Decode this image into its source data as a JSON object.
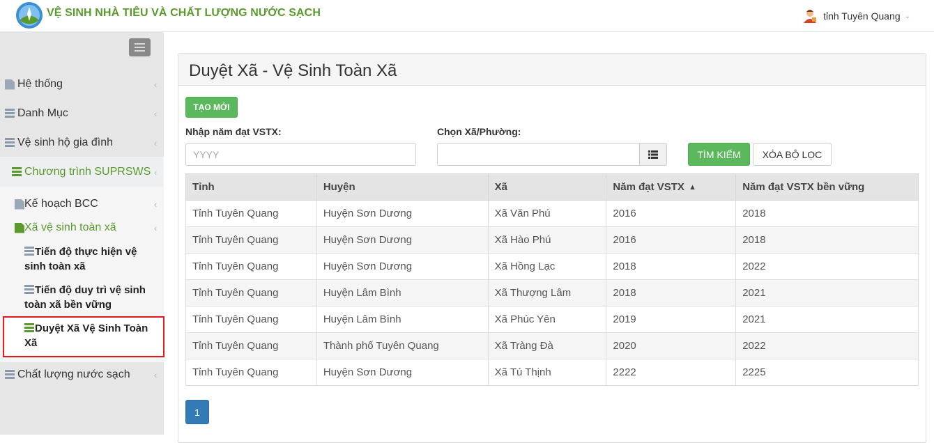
{
  "header": {
    "title": "VỆ SINH NHÀ TIÊU VÀ CHẤT LƯỢNG NƯỚC SẠCH",
    "user_name": "tỉnh Tuyên Quang",
    "brand_color": "#5a9a2c"
  },
  "sidebar": {
    "items": [
      {
        "label": "Hệ thống",
        "icon": "file-icon"
      },
      {
        "label": "Danh Mục",
        "icon": "list-icon"
      },
      {
        "label": "Vệ sinh hộ gia đình",
        "icon": "list-icon"
      },
      {
        "label": "Chương trình SUPRSWS",
        "icon": "list-icon"
      },
      {
        "label": "Kế hoạch BCC",
        "icon": "file-icon"
      },
      {
        "label": "Xã vệ sinh toàn xã",
        "icon": "file-icon"
      },
      {
        "label": "Chất lượng nước sạch",
        "icon": "list-icon"
      }
    ],
    "subitems": [
      {
        "label": "Tiến độ thực hiện vệ sinh toàn xã"
      },
      {
        "label": "Tiến độ duy trì vệ sinh toàn xã bền vững"
      },
      {
        "label": "Duyệt Xã Vệ Sinh Toàn Xã"
      }
    ]
  },
  "main": {
    "title": "Duyệt Xã - Vệ Sinh Toàn Xã",
    "create_label": "TẠO MỚI",
    "year_label": "Nhập năm đạt VSTX:",
    "year_placeholder": "YYYY",
    "commune_label": "Chọn Xã/Phường:",
    "search_label": "TÌM KIẾM",
    "clear_label": "XÓA BỘ LỌC",
    "columns": [
      "Tỉnh",
      "Huyện",
      "Xã",
      "Năm đạt VSTX",
      "Năm đạt VSTX bền vững"
    ],
    "rows": [
      [
        "Tỉnh Tuyên Quang",
        "Huyện Sơn Dương",
        "Xã Văn Phú",
        "2016",
        "2018"
      ],
      [
        "Tỉnh Tuyên Quang",
        "Huyện Sơn Dương",
        "Xã Hào Phú",
        "2016",
        "2018"
      ],
      [
        "Tỉnh Tuyên Quang",
        "Huyện Sơn Dương",
        "Xã Hồng Lạc",
        "2018",
        "2022"
      ],
      [
        "Tỉnh Tuyên Quang",
        "Huyện Lâm Bình",
        "Xã Thượng Lâm",
        "2018",
        "2021"
      ],
      [
        "Tỉnh Tuyên Quang",
        "Huyện Lâm Bình",
        "Xã Phúc Yên",
        "2019",
        "2021"
      ],
      [
        "Tỉnh Tuyên Quang",
        "Thành phố Tuyên Quang",
        "Xã Tràng Đà",
        "2020",
        "2022"
      ],
      [
        "Tỉnh Tuyên Quang",
        "Huyện Sơn Dương",
        "Xã Tú Thịnh",
        "2222",
        "2225"
      ]
    ],
    "page": "1"
  }
}
